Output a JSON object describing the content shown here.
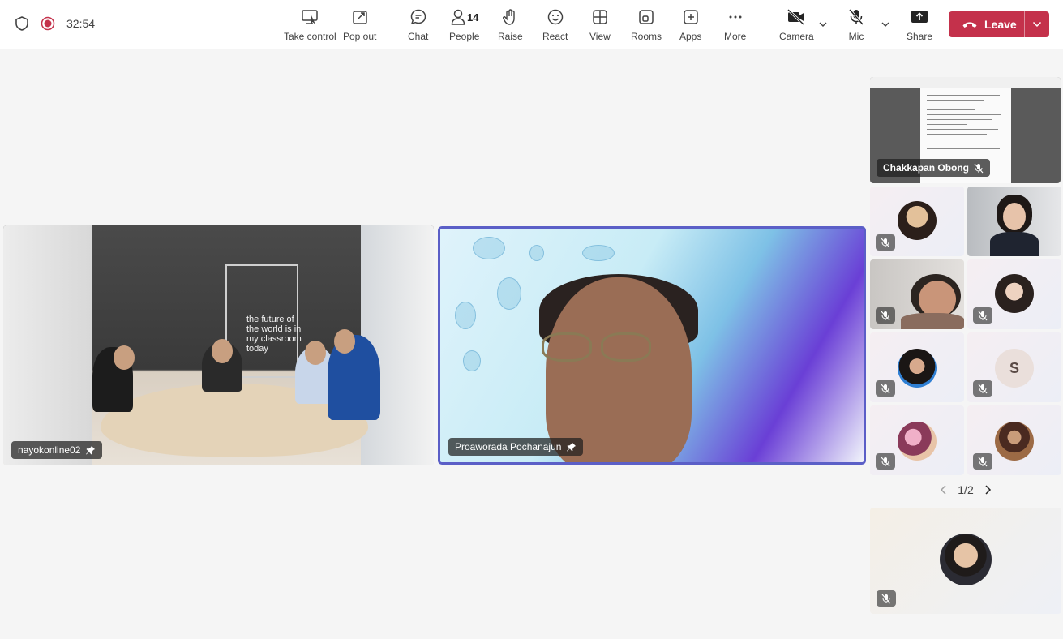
{
  "toolbar": {
    "timer": "32:54",
    "take_control": "Take control",
    "pop_out": "Pop out",
    "chat": "Chat",
    "people": "People",
    "people_count": "14",
    "raise": "Raise",
    "react": "React",
    "view": "View",
    "rooms": "Rooms",
    "apps": "Apps",
    "more": "More",
    "camera": "Camera",
    "mic": "Mic",
    "share": "Share",
    "leave": "Leave"
  },
  "stage": {
    "room_tile_name": "nayokonline02",
    "room_slogan": "the future of the world is in my classroom today",
    "speaker_tile_name": "Proaworada Pochanajun"
  },
  "rail": {
    "screen_share_name": "Chakkapan Obong",
    "letter_avatar": "S",
    "pager": "1/2"
  },
  "colors": {
    "leave_red": "#c4314b",
    "active_speaker_border": "#5b5fc7"
  }
}
